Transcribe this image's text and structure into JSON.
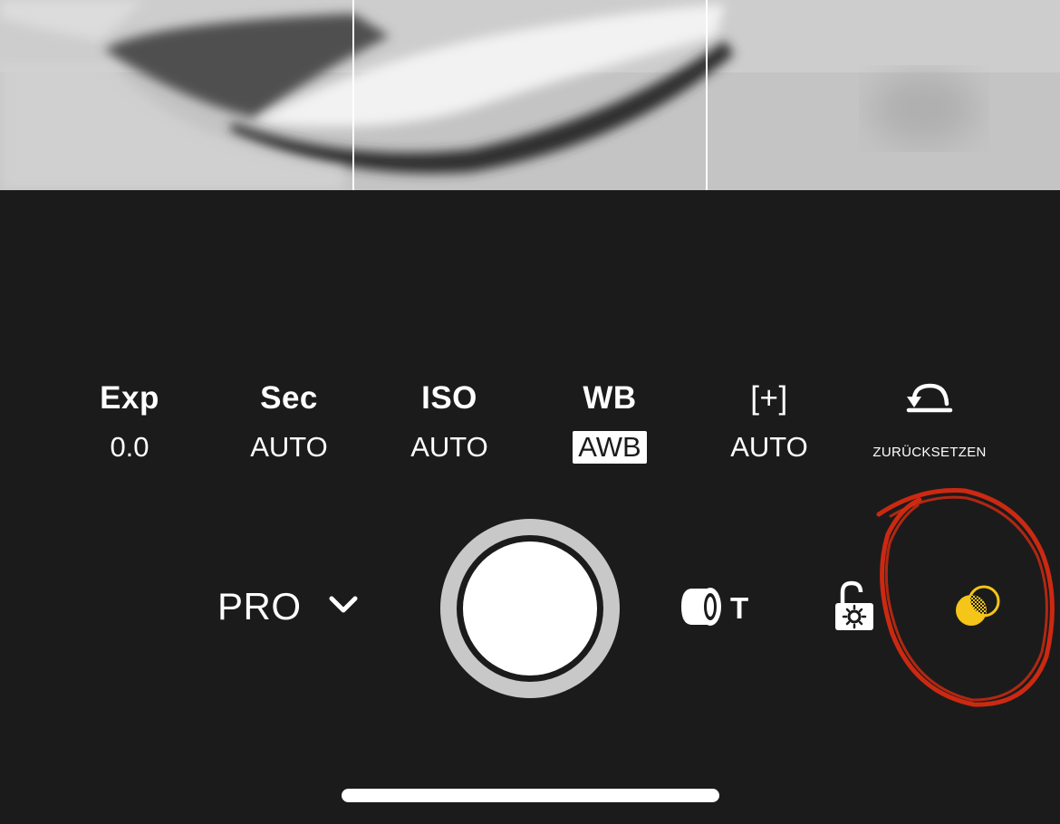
{
  "viewfinder": {
    "grid": "thirds",
    "mode": "monochrome"
  },
  "parameters": [
    {
      "key": "exposure",
      "label": "Exp",
      "value": "0.0"
    },
    {
      "key": "shutter_speed",
      "label": "Sec",
      "value": "AUTO"
    },
    {
      "key": "iso",
      "label": "ISO",
      "value": "AUTO"
    },
    {
      "key": "white_balance",
      "label": "WB",
      "value": "AWB"
    },
    {
      "key": "focus",
      "label": "[+]",
      "value": "AUTO"
    },
    {
      "key": "reset",
      "icon": "reset-arrow-icon",
      "value": "ZURÜCKSETZEN"
    }
  ],
  "mode_selector": {
    "label": "PRO",
    "icon": "chevron-down-icon"
  },
  "shutter": {
    "icon": "shutter-button"
  },
  "lens": {
    "label": "T",
    "icon": "telephoto-lens-icon"
  },
  "ae_lock": {
    "icon": "ae-lock-icon",
    "state": "unlocked"
  },
  "filter": {
    "icon": "color-filter-icon",
    "color": "#f5c518"
  },
  "annotation": {
    "color": "#d62a12",
    "shape": "hand-drawn circle"
  },
  "colors": {
    "background": "#1b1b1b",
    "text": "#ffffff",
    "shutter_ring": "#c8c8c8",
    "accent": "#f5c518"
  }
}
